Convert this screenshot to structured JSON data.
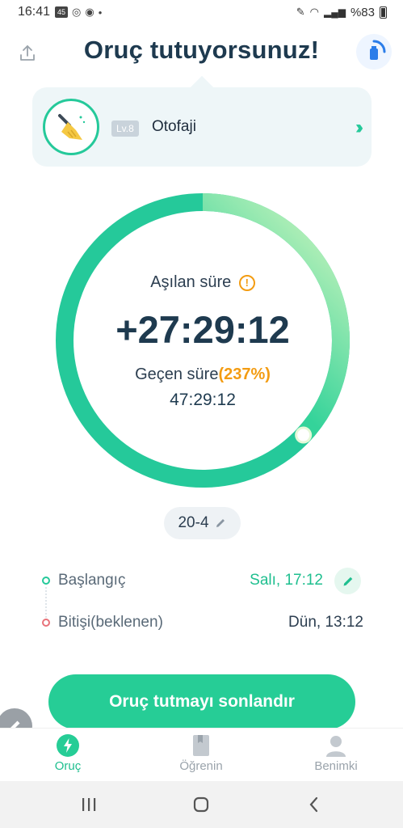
{
  "status_bar": {
    "time": "16:41",
    "badge": "45",
    "battery": "%83"
  },
  "header": {
    "title": "Oruç tutuyorsunuz!"
  },
  "level_card": {
    "level": "Lv.8",
    "stage_name": "Otofaji"
  },
  "progress": {
    "percent": 237,
    "over_label": "Aşılan süre",
    "over_time": "+27:29:12",
    "elapsed_label": "Geçen süre",
    "elapsed_percent_text": "(237%)",
    "elapsed_time": "47:29:12"
  },
  "colors": {
    "accent": "#25c99a",
    "warning": "#f39c12",
    "end_dot": "#e8727a"
  },
  "plan": {
    "label": "20-4"
  },
  "schedule": {
    "start_label": "Başlangıç",
    "start_value": "Salı, 17:12",
    "end_label": "Bitişi(beklenen)",
    "end_value": "Dün, 13:12"
  },
  "actions": {
    "end_fast": "Oruç tutmayı sonlandır"
  },
  "nav": {
    "items": [
      {
        "label": "Oruç",
        "icon": "bolt-icon"
      },
      {
        "label": "Öğrenin",
        "icon": "book-icon"
      },
      {
        "label": "Benimki",
        "icon": "person-icon"
      }
    ]
  }
}
